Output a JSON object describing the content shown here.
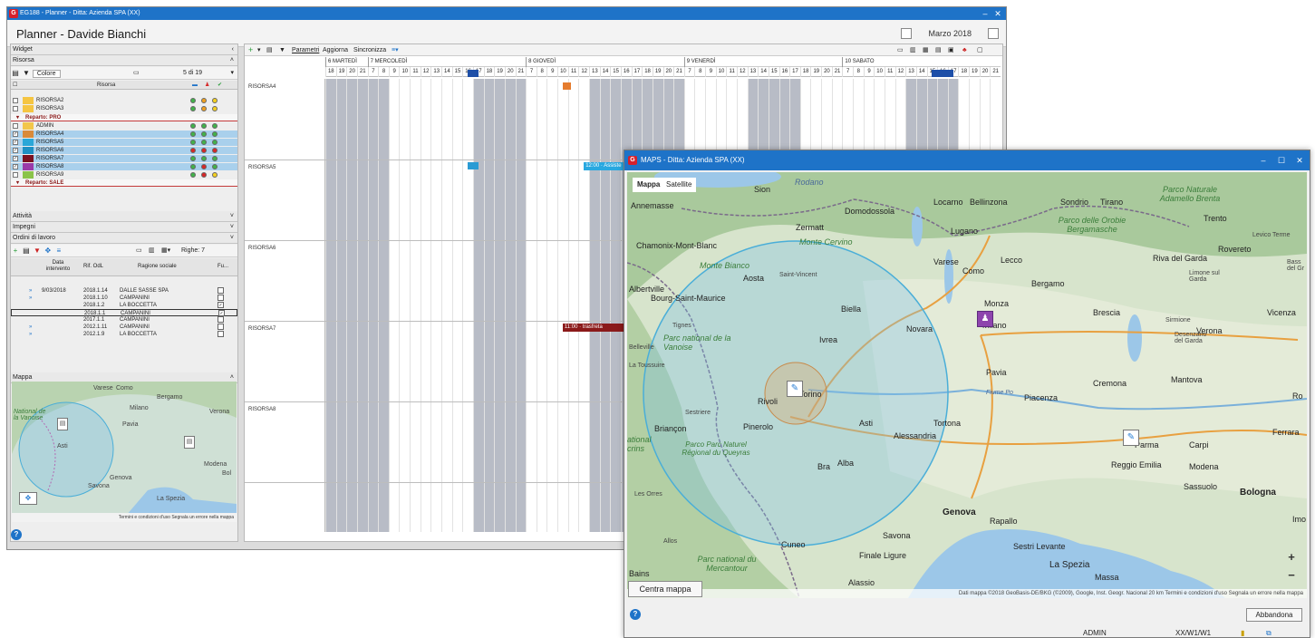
{
  "main_window": {
    "title": "EG188 - Planner - Ditta: Azienda SPA (XX)",
    "heading": "Planner - Davide Bianchi",
    "month": "Marzo 2018"
  },
  "left_panel": {
    "widget_label": "Widget",
    "risorsa": {
      "label": "Risorsa",
      "toolbar_colore": "Colore",
      "count": "5 di 19",
      "column_header": "Risorsa",
      "rows": [
        {
          "name": "RISORSA2",
          "checked": "",
          "color": "#f5c542",
          "dots": [
            "#42b24a",
            "#f0a020",
            "#f5d020"
          ]
        },
        {
          "name": "RISORSA3",
          "checked": "",
          "color": "#f5c542",
          "dots": [
            "#42b24a",
            "#f0a020",
            "#f5d020"
          ]
        }
      ],
      "group_pro": "Reparto: PRO",
      "pro_rows": [
        {
          "name": "ADMIN",
          "checked": "",
          "color": "#f2c64a",
          "dots": [
            "#42b24a",
            "#42b24a",
            "#42b24a"
          ],
          "sel": false
        },
        {
          "name": "RISORSA4",
          "checked": "✓",
          "color": "#d98a3a",
          "dots": [
            "#42b24a",
            "#42b24a",
            "#42b24a"
          ],
          "sel": true
        },
        {
          "name": "RISORSA5",
          "checked": "✓",
          "color": "#2aa7d8",
          "dots": [
            "#42b24a",
            "#42b24a",
            "#42b24a"
          ],
          "sel": true
        },
        {
          "name": "RISORSA6",
          "checked": "✓",
          "color": "#1e90c4",
          "dots": [
            "#d62828",
            "#d62828",
            "#d62828"
          ],
          "sel": true
        },
        {
          "name": "RISORSA7",
          "checked": "✓",
          "color": "#7b1020",
          "dots": [
            "#42b24a",
            "#42b24a",
            "#42b24a"
          ],
          "sel": true
        },
        {
          "name": "RISORSA8",
          "checked": "✓",
          "color": "#9b3aa8",
          "dots": [
            "#42b24a",
            "#d62828",
            "#42b24a"
          ],
          "sel": true
        },
        {
          "name": "RISORSA9",
          "checked": "",
          "color": "#8bc34a",
          "dots": [
            "#42b24a",
            "#d62828",
            "#f5d020"
          ],
          "sel": false
        }
      ],
      "group_sale": "Reparto: SALE"
    },
    "attivita_label": "Attività",
    "impegni_label": "Impegni",
    "ordini": {
      "label": "Ordini di lavoro",
      "righe": "Righe: 7",
      "col_data": "Data intervento",
      "col_rif": "Rif. OdL",
      "col_ragione": "Ragione sociale",
      "col_fu": "Fu...",
      "rows": [
        {
          "data": "9/03/2018",
          "rif": "2018.1.14",
          "ragione": "DALLE SASSE SPA",
          "fu": "",
          "arrow": "»"
        },
        {
          "data": "",
          "rif": "2018.1.10",
          "ragione": "CAMPANINI",
          "fu": "",
          "arrow": "»"
        },
        {
          "data": "",
          "rif": "2018.1.2",
          "ragione": "LA BOCCETTA",
          "fu": "✓",
          "arrow": ""
        },
        {
          "data": "",
          "rif": "2018.1.1",
          "ragione": "CAMPANINI",
          "fu": "✓",
          "arrow": ""
        },
        {
          "data": "",
          "rif": "2017.1.1",
          "ragione": "CAMPANINI",
          "fu": "",
          "arrow": ""
        },
        {
          "data": "",
          "rif": "2012.1.11",
          "ragione": "CAMPANINI",
          "fu": "",
          "arrow": "»"
        },
        {
          "data": "",
          "rif": "2012.1.9",
          "ragione": "LA BOCCETTA",
          "fu": "",
          "arrow": "»"
        }
      ]
    },
    "mappa": {
      "label": "Mappa",
      "cities": [
        "Varese",
        "Como",
        "Bergamo",
        "Milano",
        "Verona",
        "Pavia",
        "Asti",
        "Modena",
        "Genova",
        "Savona",
        "La Spezia",
        "Bol"
      ],
      "footer": "Termini e condizioni d'uso   Segnala un errore nella mappa",
      "park": "National de la Vanoise"
    }
  },
  "planner": {
    "toolbar": {
      "parametri": "Parametri",
      "aggiorna": "Aggiorna",
      "sincronizza": "Sincronizza"
    },
    "days": [
      {
        "label": "6 MARTEDÌ"
      },
      {
        "label": "7 MERCOLEDÌ"
      },
      {
        "label": "8 GIOVEDÌ"
      },
      {
        "label": "9 VENERDÌ"
      },
      {
        "label": "10 SABATO"
      }
    ],
    "resources": [
      "RISORSA4",
      "RISORSA5",
      "RISORSA6",
      "RISORSA7",
      "RISORSA8"
    ],
    "events": [
      {
        "label": "12:00 · Assiste",
        "color": "#29a8e0"
      },
      {
        "label": "11:00 · trasfreta",
        "color": "#8b1a1a"
      }
    ]
  },
  "map_dialog": {
    "title": "MAPS - Ditta: Azienda SPA (XX)",
    "tab_mappa": "Mappa",
    "tab_satellite": "Satellite",
    "cities": {
      "sion": "Sion",
      "rodano": "Rodano",
      "annemasse": "Annemasse",
      "domodossola": "Domodossola",
      "locarno": "Locarno",
      "bellinzona": "Bellinzona",
      "sondrio": "Sondrio",
      "tirano": "Tirano",
      "trento": "Trento",
      "lugano": "Lugano",
      "zermatt": "Zermatt",
      "chamonix": "Chamonix-Mont-Blanc",
      "cervino": "Monte Cervino",
      "bianco": "Monte Bianco",
      "aosta": "Aosta",
      "stvincent": "Saint-Vincent",
      "albertville": "Albertville",
      "bourg": "Bourg-Saint-Maurice",
      "biella": "Biella",
      "varese": "Varese",
      "como": "Como",
      "lecco": "Lecco",
      "bergamo": "Bergamo",
      "monza": "Monza",
      "milano": "Milano",
      "brescia": "Brescia",
      "verona": "Verona",
      "vicenza": "Vicenza",
      "novara": "Novara",
      "ivrea": "Ivrea",
      "tignes": "Tignes",
      "pavia": "Pavia",
      "cremona": "Cremona",
      "mantova": "Mantova",
      "piacenza": "Piacenza",
      "rivoli": "Rivoli",
      "torino": "Torino",
      "asti": "Asti",
      "alessandria": "Alessandria",
      "tortona": "Tortona",
      "pinerolo": "Pinerolo",
      "briancon": "Briançon",
      "bra": "Bra",
      "alba": "Alba",
      "cuneo": "Cuneo",
      "genova": "Genova",
      "savona": "Savona",
      "rapallo": "Rapallo",
      "sestri": "Sestri Levante",
      "laspezia": "La Spezia",
      "massa": "Massa",
      "finale": "Finale Ligure",
      "alassio": "Alassio",
      "parma": "Parma",
      "reggio": "Reggio Emilia",
      "modena": "Modena",
      "carpi": "Carpi",
      "sassuolo": "Sassuolo",
      "bologna": "Bologna",
      "ferrara": "Ferrara",
      "desenzano": "Desenzano del Garda",
      "sirmione": "Sirmione",
      "rivagarda": "Riva del Garda",
      "rovereto": "Rovereto",
      "limone": "Limone sul Garda",
      "levico": "Levico Terme",
      "lesorres": "Les Orres",
      "allos": "Allos",
      "bains": "Bains",
      "sestriere": "Sestriere",
      "latoussuire": "La Toussuire",
      "belleville": "Belleville",
      "imo": "Imo",
      "ro": "Ro",
      "bass": "Bass del Gr",
      "fiume_po": "Fiume Po"
    },
    "parks": {
      "adamello": "Parco Naturale Adamello Brenta",
      "orobie": "Parco delle Orobie Bergamasche",
      "vanoise": "Parc national de la Vanoise",
      "queyras": "Parco Parc Naturel Régional du Queyras",
      "mercantour": "Parc national du Mercantour",
      "national": "ational crins"
    },
    "attribution": "Dati mappa ©2018 GeoBasis-DE/BKG (©2009), Google, Inst. Geogr. Nacional   20 km   Termini e condizioni d'uso   Segnala un errore nella mappa",
    "btn_center": "Centra mappa",
    "btn_abbandona": "Abbandona",
    "status_user": "ADMIN",
    "status_path": "XX/W1/W1"
  }
}
